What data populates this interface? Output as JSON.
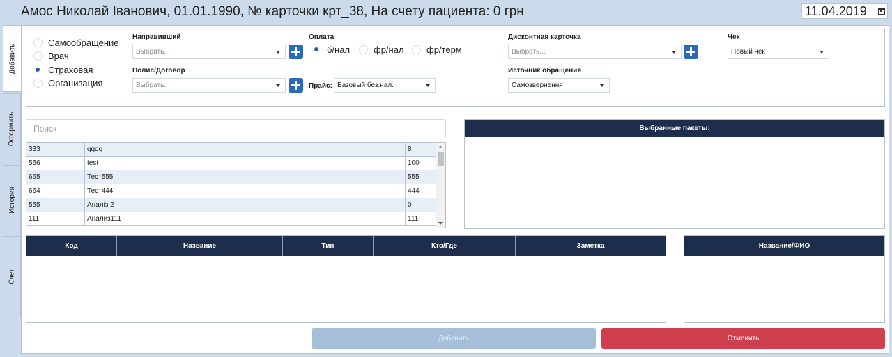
{
  "header": {
    "patient_title": "Амос Николай Іванович, 01.01.1990, № карточки крт_38, На счету пациента: 0 грн",
    "date": "11.04.2019",
    "date_icon": "calendar-icon"
  },
  "side_tabs": [
    {
      "label": "Добавить",
      "active": true
    },
    {
      "label": "Оформить",
      "active": false
    },
    {
      "label": "История",
      "active": false
    },
    {
      "label": "Счет",
      "active": false
    }
  ],
  "client_type": {
    "options": [
      "Самообращение",
      "Врач",
      "Страховая",
      "Организация"
    ],
    "selected": "Страховая"
  },
  "referrer": {
    "label": "Направивший",
    "placeholder": "Выбрать..."
  },
  "policy": {
    "label": "Полис/Договор",
    "placeholder": "Выбрать..."
  },
  "payment": {
    "label": "Оплата",
    "options": [
      "б/нал",
      "фр/нал",
      "фр/терм"
    ],
    "selected": "б/нал"
  },
  "price": {
    "label": "Прайс:",
    "value": "Базовый без.нал."
  },
  "discount_card": {
    "label": "Дисконтная карточка",
    "placeholder": "Выбрать..."
  },
  "source": {
    "label": "Источник обращения",
    "value": "Самозвернення"
  },
  "receipt": {
    "label": "Чек",
    "value": "Новый чек"
  },
  "search": {
    "placeholder": "Поиск"
  },
  "services": [
    {
      "code": "333",
      "name": "qqqq",
      "price": "8"
    },
    {
      "code": "556",
      "name": "test",
      "price": "100"
    },
    {
      "code": "665",
      "name": "Тест555",
      "price": "555"
    },
    {
      "code": "664",
      "name": "Тест444",
      "price": "444"
    },
    {
      "code": "555",
      "name": "Аналіз 2",
      "price": "0"
    },
    {
      "code": "111",
      "name": "Анализ111",
      "price": "111"
    }
  ],
  "packages": {
    "title": "Выбранные пакеты:"
  },
  "orders_table": {
    "columns": [
      "Код",
      "Название",
      "Тип",
      "Кто/Где",
      "Заметка"
    ]
  },
  "names_table": {
    "title": "Название/ФИО"
  },
  "buttons": {
    "add": "Добавить",
    "cancel": "Отменить"
  },
  "colors": {
    "accent_blue": "#2b6bb5",
    "header_dark": "#1d2e4d",
    "cancel_red": "#cf3f4d",
    "add_disabled": "#a4bfd7",
    "background": "#ccdbec"
  }
}
